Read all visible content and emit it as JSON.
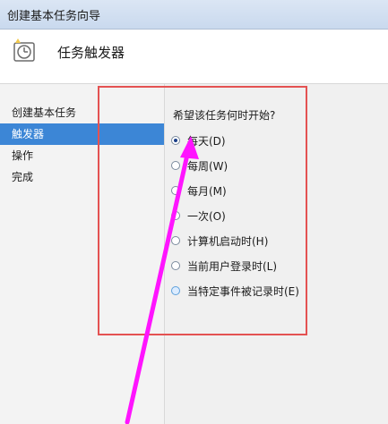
{
  "window": {
    "title": "创建基本任务向导"
  },
  "header": {
    "title": "任务触发器",
    "icon": "calendar-clock-icon"
  },
  "sidebar": {
    "items": [
      {
        "label": "创建基本任务"
      },
      {
        "label": "触发器"
      },
      {
        "label": "操作"
      },
      {
        "label": "完成"
      }
    ]
  },
  "main": {
    "question": "希望该任务何时开始?",
    "options": [
      {
        "label": "每天(D)",
        "selected": true
      },
      {
        "label": "每周(W)",
        "selected": false
      },
      {
        "label": "每月(M)",
        "selected": false
      },
      {
        "label": "一次(O)",
        "selected": false
      },
      {
        "label": "计算机启动时(H)",
        "selected": false
      },
      {
        "label": "当前用户登录时(L)",
        "selected": false
      },
      {
        "label": "当特定事件被记录时(E)",
        "selected": false
      }
    ]
  },
  "colors": {
    "highlight": "#e45252",
    "arrow": "#ff14ff",
    "selection": "#3c86d6"
  }
}
